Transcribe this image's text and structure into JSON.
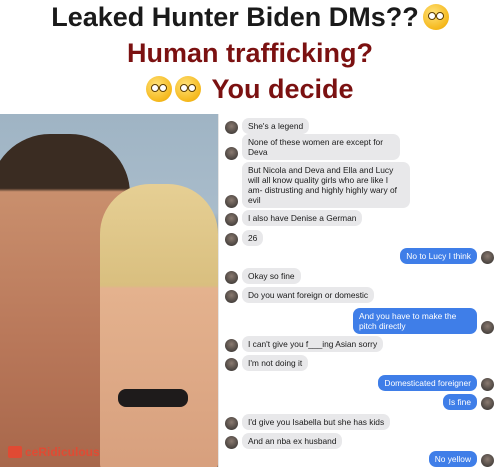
{
  "header": {
    "headline": "Leaked Hunter Biden DMs??",
    "line2": "Human trafficking?",
    "line3": "You decide"
  },
  "icons": {
    "headline_emoji": "flushed-face-emoji",
    "thinking_emoji": "thinking-face-emoji",
    "monocle_emoji": "monocle-face-emoji"
  },
  "watermark": {
    "text": "ceRidiculous"
  },
  "messages": [
    {
      "dir": "in",
      "text": "She's a legend"
    },
    {
      "dir": "in",
      "text": "None of these women are except for Deva"
    },
    {
      "dir": "in",
      "text": "But Nicola and Deva and Ella and Lucy will all know quality girls who are like I am- distrusting and highly highly wary of evil"
    },
    {
      "dir": "in",
      "text": "I also have Denise a German"
    },
    {
      "dir": "in",
      "text": "26"
    },
    {
      "dir": "out",
      "text": "No to Lucy I think"
    },
    {
      "dir": "in",
      "text": "Okay so fine"
    },
    {
      "dir": "in",
      "text": "Do you want foreign or domestic"
    },
    {
      "dir": "out",
      "text": "And you have to make the pitch directly"
    },
    {
      "dir": "in",
      "text": "I can't give you f___ing Asian sorry"
    },
    {
      "dir": "in",
      "text": "I'm not doing it"
    },
    {
      "dir": "out",
      "text": "Domesticated foreigner"
    },
    {
      "dir": "out",
      "text": "Is fine"
    },
    {
      "dir": "in",
      "text": "I'd give you Isabella but she has kids"
    },
    {
      "dir": "in",
      "text": "And an nba ex husband"
    },
    {
      "dir": "out",
      "text": "No yellow"
    }
  ],
  "colors": {
    "headline": "#1a1a1a",
    "subline": "#7b1111",
    "incoming_bubble": "#e8e8ea",
    "outgoing_bubble": "#3f7ee8",
    "watermark": "#e14a33"
  }
}
